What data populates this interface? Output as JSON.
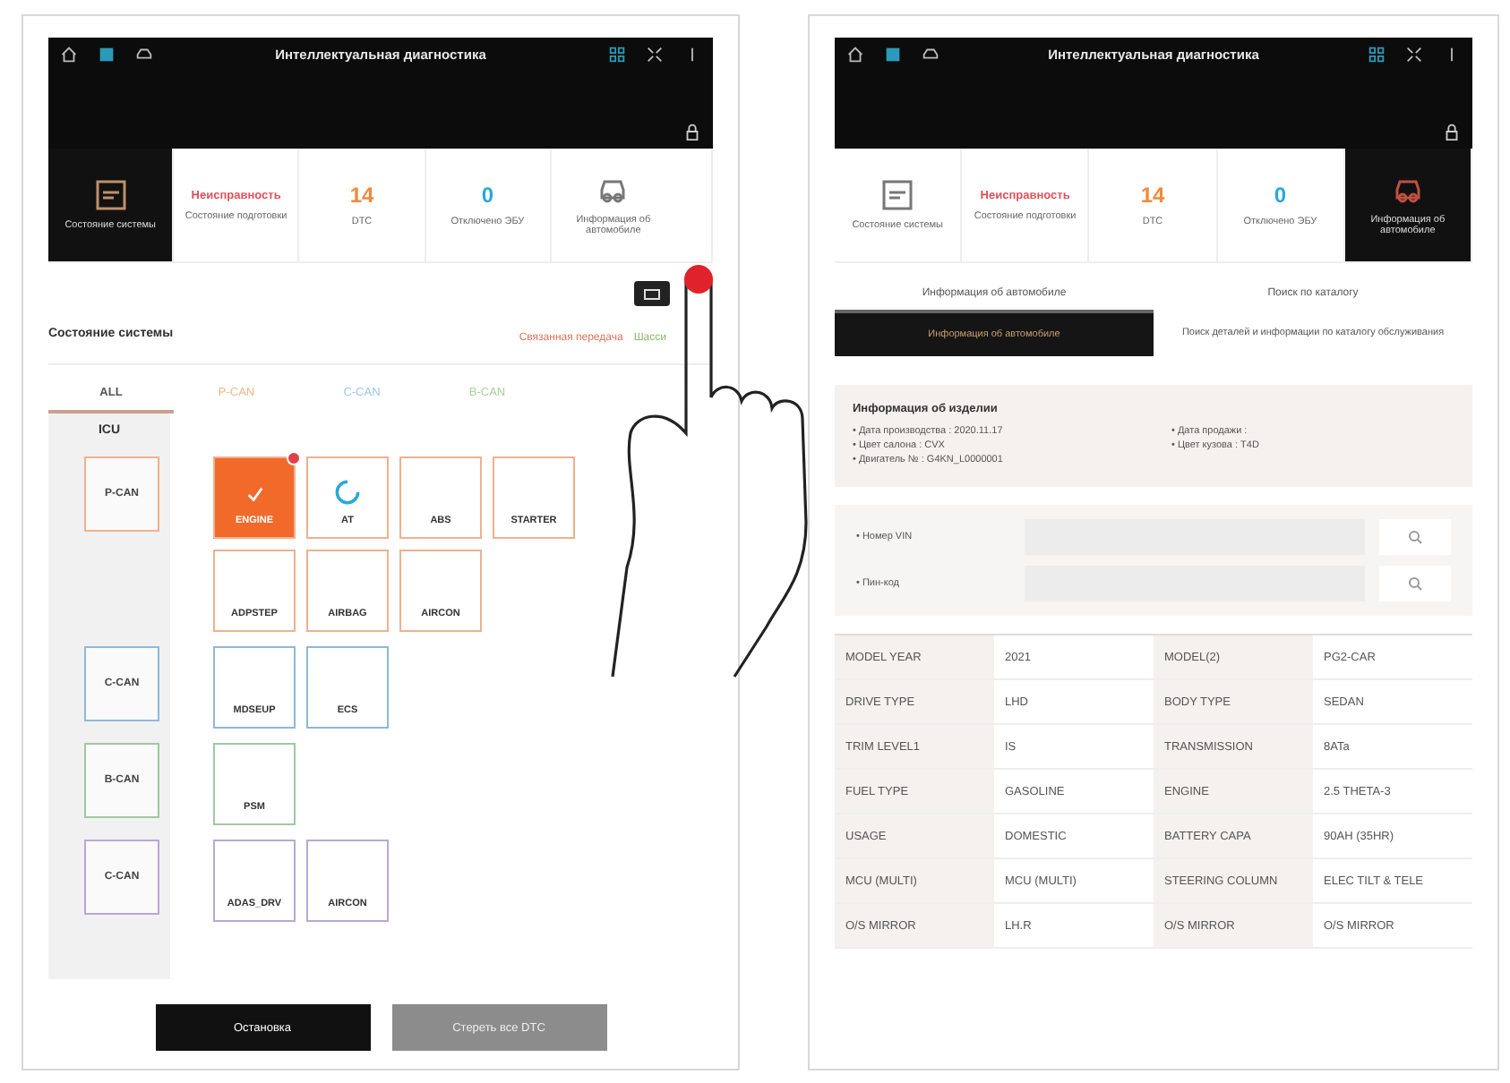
{
  "left_screen": {
    "header": {
      "title": "Интеллектуальная диагностика"
    },
    "stats": [
      {
        "kind": "icon",
        "label": "Состояние системы",
        "selected": true
      },
      {
        "kind": "text",
        "value": "Неисправность",
        "label": "Состояние подготовки",
        "color": "#e0505a",
        "selected": false
      },
      {
        "kind": "number",
        "value": "14",
        "label": "DTC",
        "color": "#f08a3c",
        "selected": false
      },
      {
        "kind": "number",
        "value": "0",
        "label": "Отключено ЭБУ",
        "color": "#29a8d8",
        "selected": false
      },
      {
        "kind": "icon",
        "label": "Информация об автомобиле",
        "selected": false
      }
    ],
    "section_title": "Состояние системы",
    "legend": [
      {
        "label": "Связанная передача",
        "color": "#e0705a"
      },
      {
        "label": "Шасси",
        "color": "#8cb86a"
      }
    ],
    "tabs": [
      {
        "label": "ALL",
        "selected": true,
        "color": "#555555"
      },
      {
        "label": "P-CAN",
        "selected": false,
        "color": "#f0b888"
      },
      {
        "label": "C-CAN",
        "selected": false,
        "color": "#9cc8e0"
      },
      {
        "label": "B-CAN",
        "selected": false,
        "color": "#a8d0a0"
      }
    ],
    "column_title": "ICU",
    "buses": [
      {
        "name": "P-CAN",
        "color": "#f0b090",
        "modules": [
          {
            "name": "ENGINE",
            "kind": "done"
          },
          {
            "name": "AT",
            "kind": "loading"
          },
          {
            "name": "ABS",
            "kind": "idle"
          },
          {
            "name": "STARTER",
            "kind": "idle"
          },
          {
            "name": "ADPSTEP",
            "kind": "idle"
          },
          {
            "name": "AIRBAG",
            "kind": "idle"
          },
          {
            "name": "AIRCON",
            "kind": "idle"
          }
        ]
      },
      {
        "name": "C-CAN",
        "color": "#90b8d8",
        "modules": [
          {
            "name": "MDSEUP",
            "kind": "idle"
          },
          {
            "name": "ECS",
            "kind": "idle"
          }
        ]
      },
      {
        "name": "B-CAN",
        "color": "#a0c8a0",
        "modules": [
          {
            "name": "PSM",
            "kind": "idle"
          }
        ]
      },
      {
        "name": "C-CAN",
        "color": "#b8a8d8",
        "modules": [
          {
            "name": "ADAS_DRV",
            "kind": "idle"
          },
          {
            "name": "AIRCON",
            "kind": "idle"
          }
        ]
      }
    ],
    "buttons": [
      {
        "label": "Остановка",
        "disabled": false
      },
      {
        "label": "Стереть все DTC",
        "disabled": true
      }
    ]
  },
  "right_screen": {
    "header": {
      "title": "Интеллектуальная диагностика"
    },
    "stats": [
      {
        "kind": "icon",
        "label": "Состояние системы",
        "selected": false
      },
      {
        "kind": "text",
        "value": "Неисправность",
        "label": "Состояние подготовки",
        "color": "#e0505a",
        "selected": false
      },
      {
        "kind": "number",
        "value": "14",
        "label": "DTC",
        "color": "#f08a3c",
        "selected": false
      },
      {
        "kind": "number",
        "value": "0",
        "label": "Отключено ЭБУ",
        "color": "#29a8d8",
        "selected": false
      },
      {
        "kind": "icon",
        "label": "Информация об автомобиле",
        "selected": true
      }
    ],
    "tabs": [
      {
        "caption": "Информация об автомобиле",
        "label": "Информация об автомобиле",
        "selected": true
      },
      {
        "caption": "Поиск по каталогу",
        "label": "Поиск деталей и информации по каталогу обслуживания",
        "selected": false
      }
    ],
    "info": {
      "title": "Информация об изделии",
      "left": [
        "• Дата производства : 2020.11.17",
        "• Цвет салона : CVX",
        "• Двигатель № : G4KN_L0000001"
      ],
      "right": [
        "• Дата продажи :",
        "• Цвет кузова : T4D"
      ]
    },
    "search_fields": [
      {
        "label": "• Номер VIN"
      },
      {
        "label": "• Пин-код"
      }
    ],
    "table": [
      [
        "MODEL YEAR",
        "2021",
        "MODEL(2)",
        "PG2-CAR"
      ],
      [
        "DRIVE TYPE",
        "LHD",
        "BODY TYPE",
        "SEDAN"
      ],
      [
        "TRIM LEVEL1",
        "IS",
        "TRANSMISSION",
        "8ATa"
      ],
      [
        "FUEL TYPE",
        "GASOLINE",
        "ENGINE",
        "2.5 THETA-3"
      ],
      [
        "USAGE",
        "DOMESTIC",
        "BATTERY CAPA",
        "90AH (35HR)"
      ],
      [
        "MCU (MULTI)",
        "MCU (MULTI)",
        "STEERING COLUMN",
        "ELEC TILT & TELE"
      ],
      [
        "O/S MIRROR",
        "LH.R",
        "O/S MIRROR",
        "O/S MIRROR"
      ]
    ]
  }
}
